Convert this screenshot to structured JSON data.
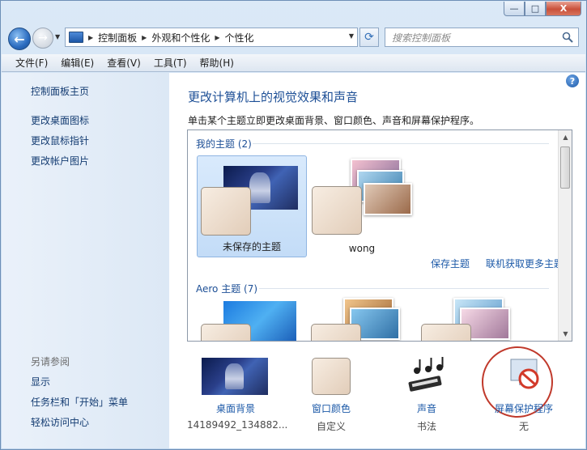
{
  "window": {
    "caption": {
      "minimize": "—",
      "maximize": "□",
      "close": "X"
    }
  },
  "nav": {
    "back_icon": "←",
    "forward_icon": "→",
    "breadcrumbs": [
      "控制面板",
      "外观和个性化",
      "个性化"
    ],
    "search_placeholder": "搜索控制面板",
    "refresh_icon": "⟳"
  },
  "menubar": [
    "文件(F)",
    "编辑(E)",
    "查看(V)",
    "工具(T)",
    "帮助(H)"
  ],
  "sidebar": {
    "home": "控制面板主页",
    "links": [
      "更改桌面图标",
      "更改鼠标指针",
      "更改帐户图片"
    ],
    "see_also_header": "另请参阅",
    "see_also": [
      "显示",
      "任务栏和「开始」菜单",
      "轻松访问中心"
    ]
  },
  "main": {
    "help_icon": "?",
    "title": "更改计算机上的视觉效果和声音",
    "description": "单击某个主题立即更改桌面背景、窗口颜色、声音和屏幕保护程序。",
    "my_themes_header": "我的主题 (2)",
    "my_themes": [
      {
        "label": "未保存的主题",
        "selected": true
      },
      {
        "label": "wong",
        "selected": false
      }
    ],
    "save_theme": "保存主题",
    "get_more_themes": "联机获取更多主题",
    "aero_header": "Aero 主题 (7)"
  },
  "bottom": [
    {
      "label": "桌面背景",
      "value": "14189492_134882..."
    },
    {
      "label": "窗口颜色",
      "value": "自定义"
    },
    {
      "label": "声音",
      "value": "书法"
    },
    {
      "label": "屏幕保护程序",
      "value": "无"
    }
  ],
  "colors": {
    "link": "#1d5aa8",
    "title": "#1d4f96",
    "selection": "#c3dcf7"
  }
}
